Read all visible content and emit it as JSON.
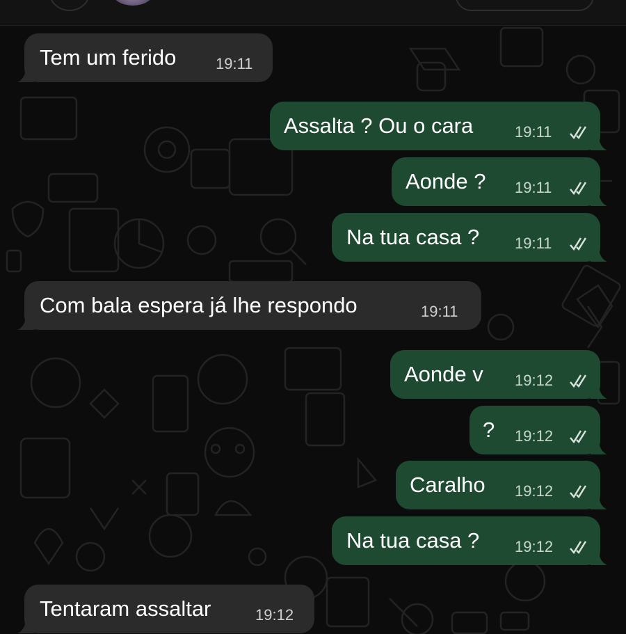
{
  "chat": {
    "messages": [
      {
        "direction": "incoming",
        "text": "Tem um ferido",
        "time": "19:11"
      },
      {
        "direction": "outgoing",
        "text": "Assalta ? Ou o cara",
        "time": "19:11",
        "status": "read-ticks-icon"
      },
      {
        "direction": "outgoing",
        "text": "Aonde ?",
        "time": "19:11",
        "status": "read-ticks-icon"
      },
      {
        "direction": "outgoing",
        "text": "Na tua casa ?",
        "time": "19:11",
        "status": "read-ticks-icon"
      },
      {
        "direction": "incoming",
        "text": "Com bala espera já lhe respondo",
        "time": "19:11"
      },
      {
        "direction": "outgoing",
        "text": "Aonde v",
        "time": "19:12",
        "status": "read-ticks-icon"
      },
      {
        "direction": "outgoing",
        "text": "?",
        "time": "19:12",
        "status": "read-ticks-icon"
      },
      {
        "direction": "outgoing",
        "text": "Caralho",
        "time": "19:12",
        "status": "read-ticks-icon"
      },
      {
        "direction": "outgoing",
        "text": "Na tua casa ?",
        "time": "19:12",
        "status": "read-ticks-icon"
      },
      {
        "direction": "incoming",
        "text": "Tentaram assaltar",
        "time": "19:12"
      }
    ]
  },
  "colors": {
    "background": "#0c0c0c",
    "incoming_bubble": "#2b2b2b",
    "outgoing_bubble": "#1e4a32"
  }
}
